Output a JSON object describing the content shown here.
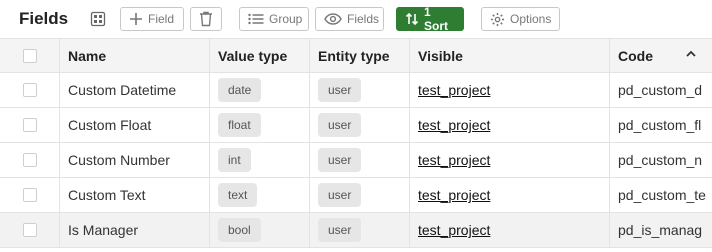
{
  "toolbar": {
    "title": "Fields",
    "add_field_label": "Field",
    "group_label": "Group",
    "fields_label": "Fields",
    "sort_label": "1 Sort",
    "options_label": "Options"
  },
  "table": {
    "columns": [
      "Name",
      "Value type",
      "Entity type",
      "Visible",
      "Code"
    ],
    "sorted_column": "Code",
    "rows": [
      {
        "name": "Custom Datetime",
        "value_type": "date",
        "entity_type": "user",
        "visible": "test_project",
        "code": "pd_custom_d"
      },
      {
        "name": "Custom Float",
        "value_type": "float",
        "entity_type": "user",
        "visible": "test_project",
        "code": "pd_custom_fl"
      },
      {
        "name": "Custom Number",
        "value_type": "int",
        "entity_type": "user",
        "visible": "test_project",
        "code": "pd_custom_n"
      },
      {
        "name": "Custom Text",
        "value_type": "text",
        "entity_type": "user",
        "visible": "test_project",
        "code": "pd_custom_te"
      },
      {
        "name": "Is Manager",
        "value_type": "bool",
        "entity_type": "user",
        "visible": "test_project",
        "code": "pd_is_manag"
      }
    ]
  },
  "colors": {
    "sort_button": "#2e7d32",
    "header_bg": "#f4f4f4",
    "chip_bg": "#e6e6e6"
  }
}
